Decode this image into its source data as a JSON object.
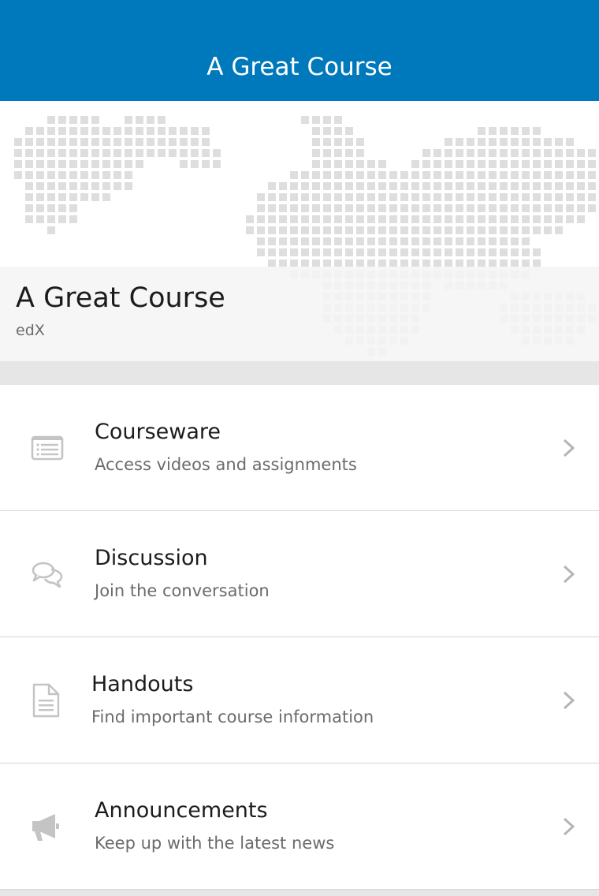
{
  "navbar": {
    "title": "A Great Course"
  },
  "course": {
    "title": "A Great Course",
    "org": "edX"
  },
  "menu": [
    {
      "label": "Courseware",
      "subtitle": "Access videos and assignments",
      "icon": "list-icon"
    },
    {
      "label": "Discussion",
      "subtitle": "Join the conversation",
      "icon": "chat-bubbles-icon"
    },
    {
      "label": "Handouts",
      "subtitle": "Find important course information",
      "icon": "document-icon"
    },
    {
      "label": "Announcements",
      "subtitle": "Keep up with the latest news",
      "icon": "megaphone-icon"
    }
  ],
  "colors": {
    "brand": "#0079bc",
    "icon_gray": "#c4c4c4",
    "divider": "#d6d6d6"
  }
}
